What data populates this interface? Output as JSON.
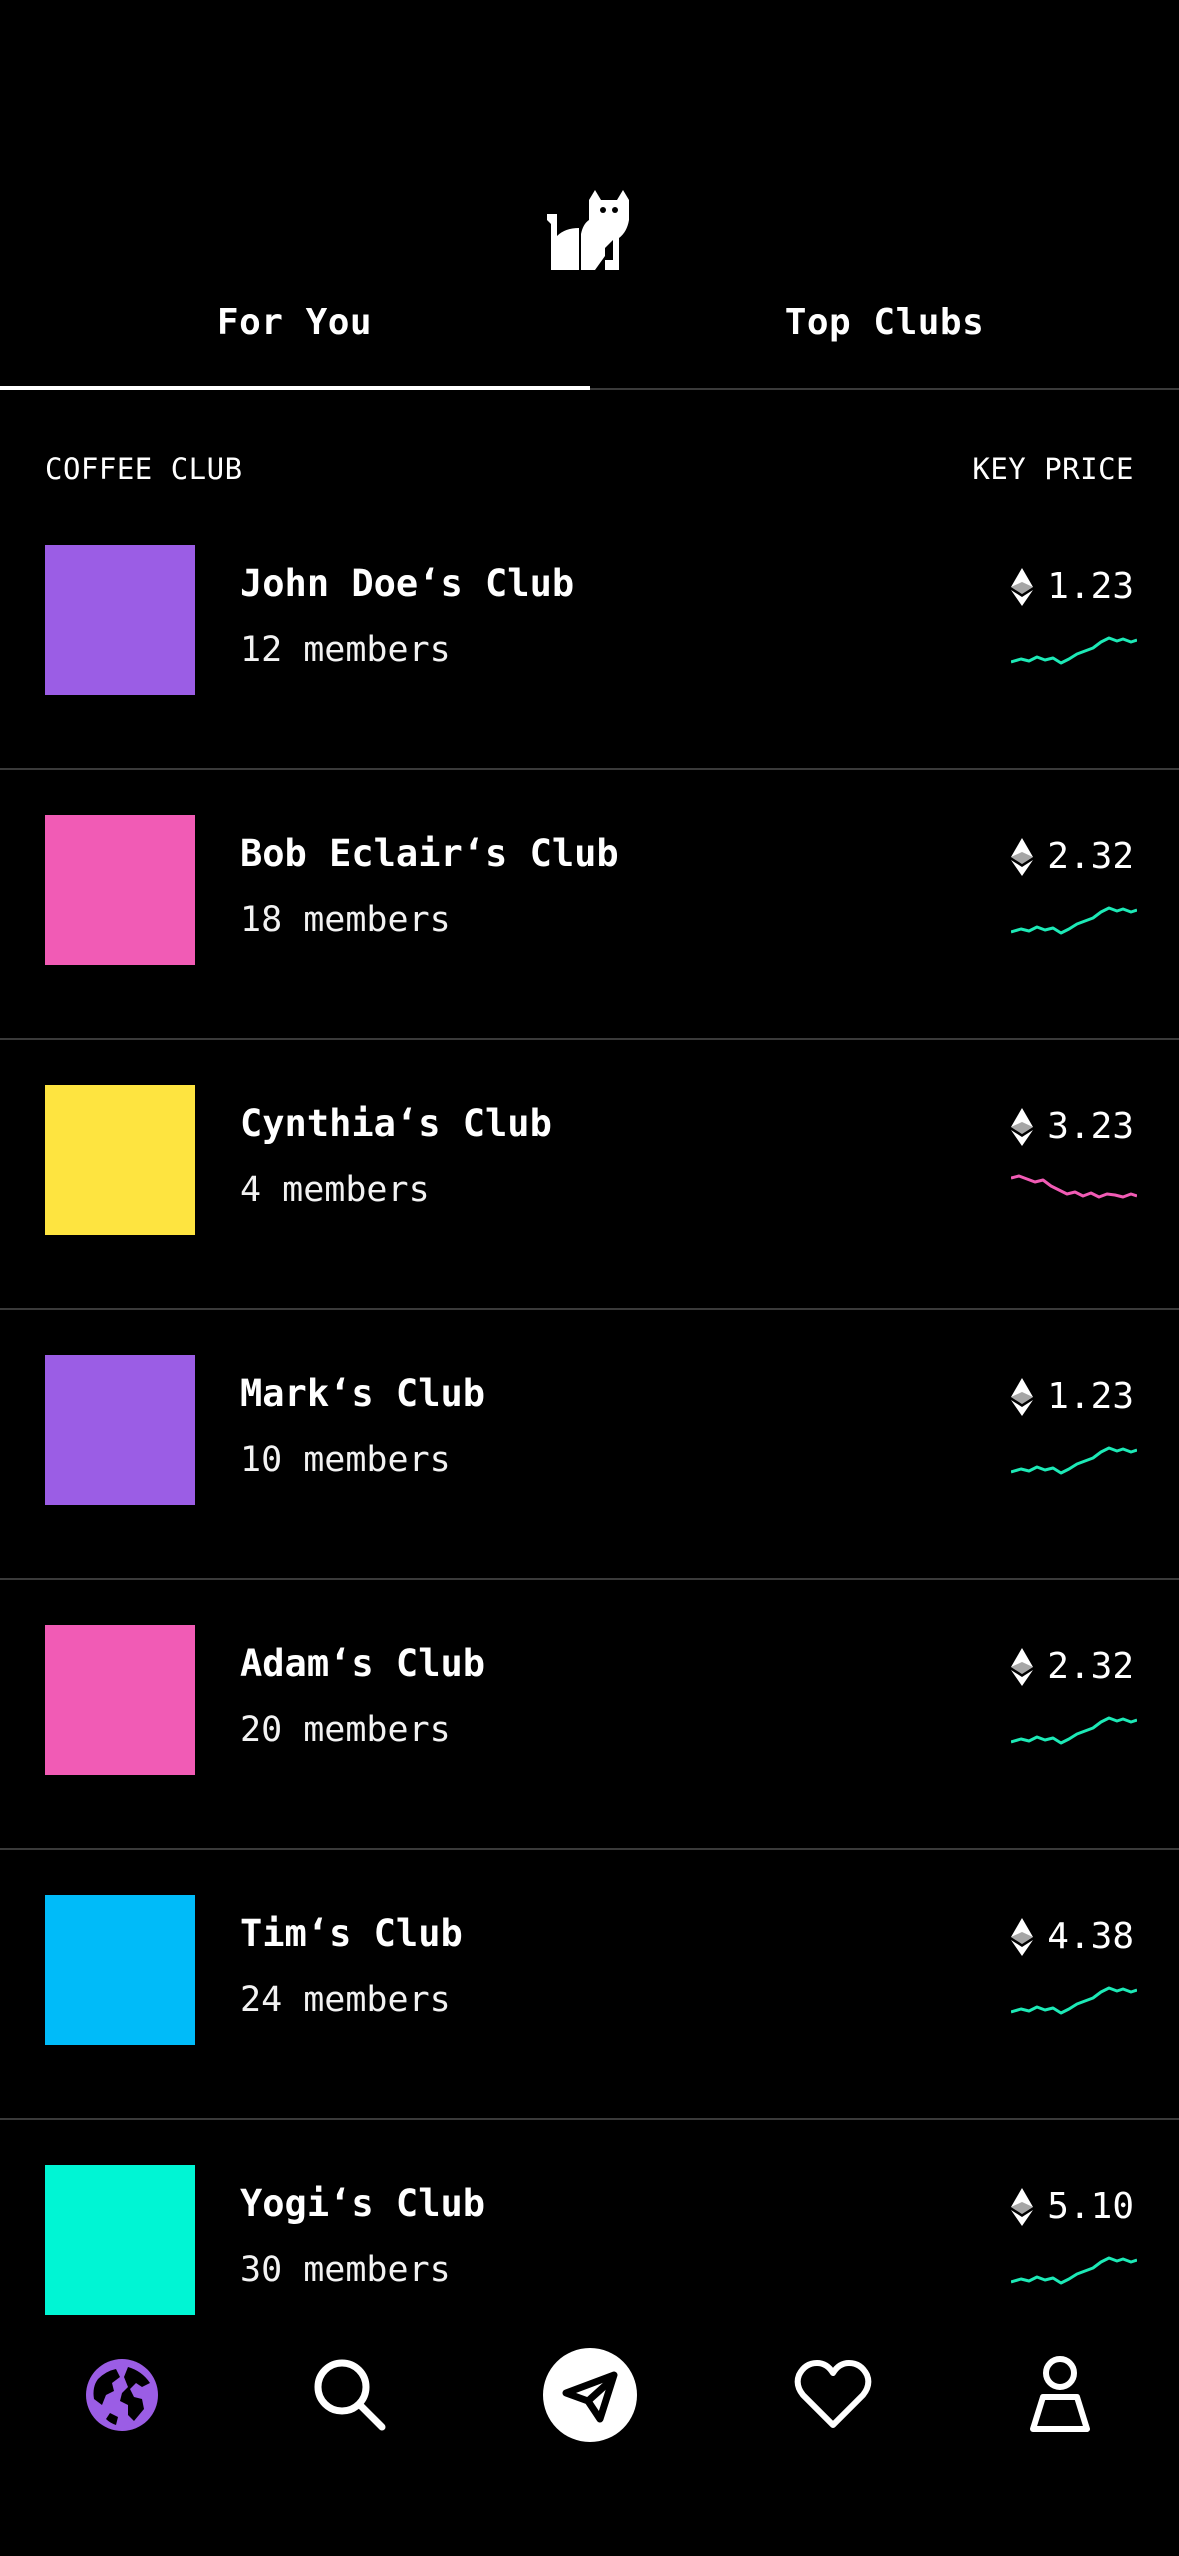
{
  "tabs": {
    "for_you": "For You",
    "top_clubs": "Top Clubs"
  },
  "list_header": {
    "left": "COFFEE CLUB",
    "right": "KEY PRICE"
  },
  "clubs": [
    {
      "name": "John Doe‘s Club",
      "members": "12 members",
      "price": "1.23",
      "color": "#9b5de5",
      "trend": "up"
    },
    {
      "name": "Bob Eclair‘s Club",
      "members": "18 members",
      "price": "2.32",
      "color": "#f15bb5",
      "trend": "up"
    },
    {
      "name": "Cynthia‘s Club",
      "members": "4 members",
      "price": "3.23",
      "color": "#fee440",
      "trend": "down"
    },
    {
      "name": "Mark‘s Club",
      "members": "10 members",
      "price": "1.23",
      "color": "#9b5de5",
      "trend": "up"
    },
    {
      "name": "Adam‘s Club",
      "members": "20 members",
      "price": "2.32",
      "color": "#f15bb5",
      "trend": "up"
    },
    {
      "name": "Tim‘s Club",
      "members": "24 members",
      "price": "4.38",
      "color": "#00bbf9",
      "trend": "up"
    },
    {
      "name": "Yogi‘s Club",
      "members": "30 members",
      "price": "5.10",
      "color": "#00f5d4",
      "trend": "up"
    }
  ],
  "trend_colors": {
    "up": "#1de9b6",
    "down": "#f15bb5"
  },
  "nav": {
    "items": [
      "globe-icon",
      "search-icon",
      "send-icon",
      "heart-icon",
      "profile-icon"
    ],
    "active": "globe-icon",
    "active_color": "#9b5de5"
  }
}
